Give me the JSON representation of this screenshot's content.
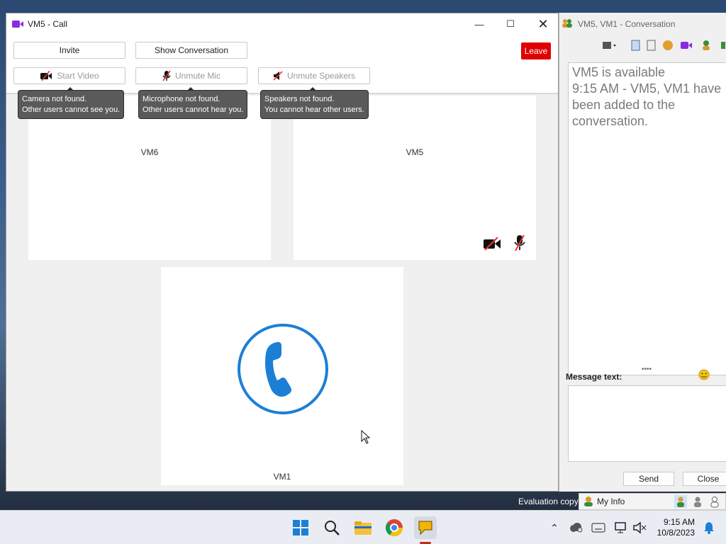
{
  "call_window": {
    "title": "VM5 - Call",
    "invite_label": "Invite",
    "show_conversation_label": "Show Conversation",
    "leave_label": "Leave",
    "start_video_label": "Start Video",
    "unmute_mic_label": "Unmute Mic",
    "unmute_speakers_label": "Unmute Speakers",
    "tooltips": {
      "camera": [
        "Camera not found.",
        "Other users cannot see you."
      ],
      "microphone": [
        "Microphone not found.",
        "Other users cannot hear you."
      ],
      "speakers": [
        "Speakers not found.",
        "You cannot hear other users."
      ]
    },
    "participants": [
      "VM6",
      "VM5",
      "VM1"
    ]
  },
  "conversation_window": {
    "title": "VM5, VM1 - Conversation",
    "log": [
      "VM5 is available",
      "9:15 AM - VM5, VM1 have been added to the conversation."
    ],
    "message_label": "Message text:",
    "send_label": "Send",
    "close_label": "Close"
  },
  "status_strip": {
    "evaluation_label": "Evaluation copy",
    "my_info_label": "My Info"
  },
  "taskbar": {
    "time": "9:15 AM",
    "date": "10/8/2023"
  },
  "colors": {
    "leave": "#e00000",
    "phone_blue": "#1c7fd6",
    "video_purple": "#8a2be2"
  }
}
